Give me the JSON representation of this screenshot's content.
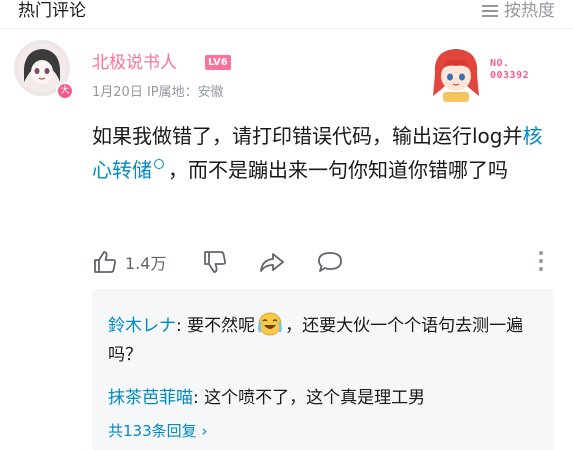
{
  "header": {
    "section_title": "热门评论",
    "sort_label": "按热度"
  },
  "comment": {
    "username": "北极说书人",
    "level": "LV6",
    "avatar_badge": "大",
    "date": "1月20日",
    "ip_location": "IP属地：安徽",
    "fan_number_top": "NO.",
    "fan_number_bottom": "003392",
    "text_part1": "如果我做错了，请打印错误代码，输出运行log并",
    "keyword": "核心转储",
    "text_part2": "，而不是蹦出来一句你知道你错哪了吗",
    "like_count": "1.4万"
  },
  "replies": [
    {
      "name": "鈴木レナ",
      "text_before_emoji": ": 要不然呢",
      "emoji": "crying-laugh-emoji",
      "text_after_emoji": "，还要大伙一个个语句去测一遍吗？"
    },
    {
      "name": "抹茶芭菲喵",
      "text": ": 这个喷不了，这个真是理工男"
    }
  ],
  "more_replies": "共133条回复 ›",
  "colors": {
    "accent_pink": "#fb7299",
    "link_blue": "#008ac5",
    "muted": "#9499a0",
    "reply_bg": "#f6f7f8"
  }
}
